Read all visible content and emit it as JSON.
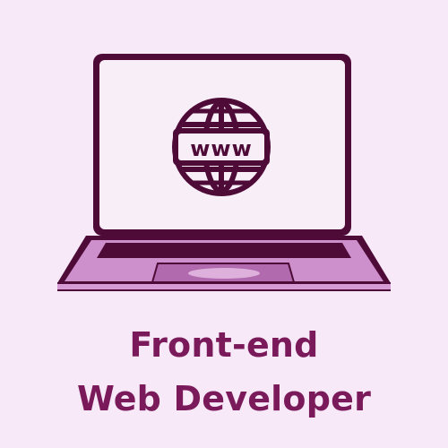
{
  "title": {
    "line1": "Front-end",
    "line2": "Web Developer"
  },
  "illustration": {
    "subject": "laptop",
    "screen_icon": "www-globe-icon",
    "globe_text": "www"
  },
  "colors": {
    "background": "#f7e9f7",
    "outline": "#4e0b38",
    "screen": "#f8eef8",
    "keyboard_deck": "#ce90cc",
    "keyboard_deck_dark": "#b06aad",
    "text": "#7a1a5b"
  }
}
